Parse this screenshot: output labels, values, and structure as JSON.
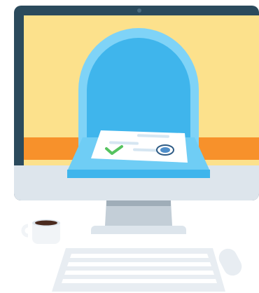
{
  "illustration": {
    "colors": {
      "bezel": "#2b4a5c",
      "screen": "#fce18c",
      "screen_stripe": "#f7912b",
      "monitor_chin": "#dde5ec",
      "stand": "#c3ced7",
      "stand_shadow": "#9fadb8",
      "mailbox_outer": "#7fd3f7",
      "mailbox_inner": "#3fb5ec",
      "slot_tray": "#6fcdf5",
      "slot_tray_front": "#3fb5ec",
      "letter": "#ffffff",
      "letter_lines": "#d6e6f2",
      "check": "#55c35f",
      "stamp_ring": "#2f5c86",
      "stamp_fill": "#4f8ec9",
      "keyboard": "#e8edf2",
      "keyboard_keys": "#ffffff",
      "mouse": "#e8edf2",
      "cup": "#f1f4f7",
      "coffee": "#4a2a1e"
    },
    "elements": [
      "monitor",
      "webcam-dot",
      "mailbox-arch",
      "email-letter",
      "checkmark-icon",
      "stamp-icon",
      "coffee-cup",
      "keyboard",
      "mouse"
    ]
  }
}
